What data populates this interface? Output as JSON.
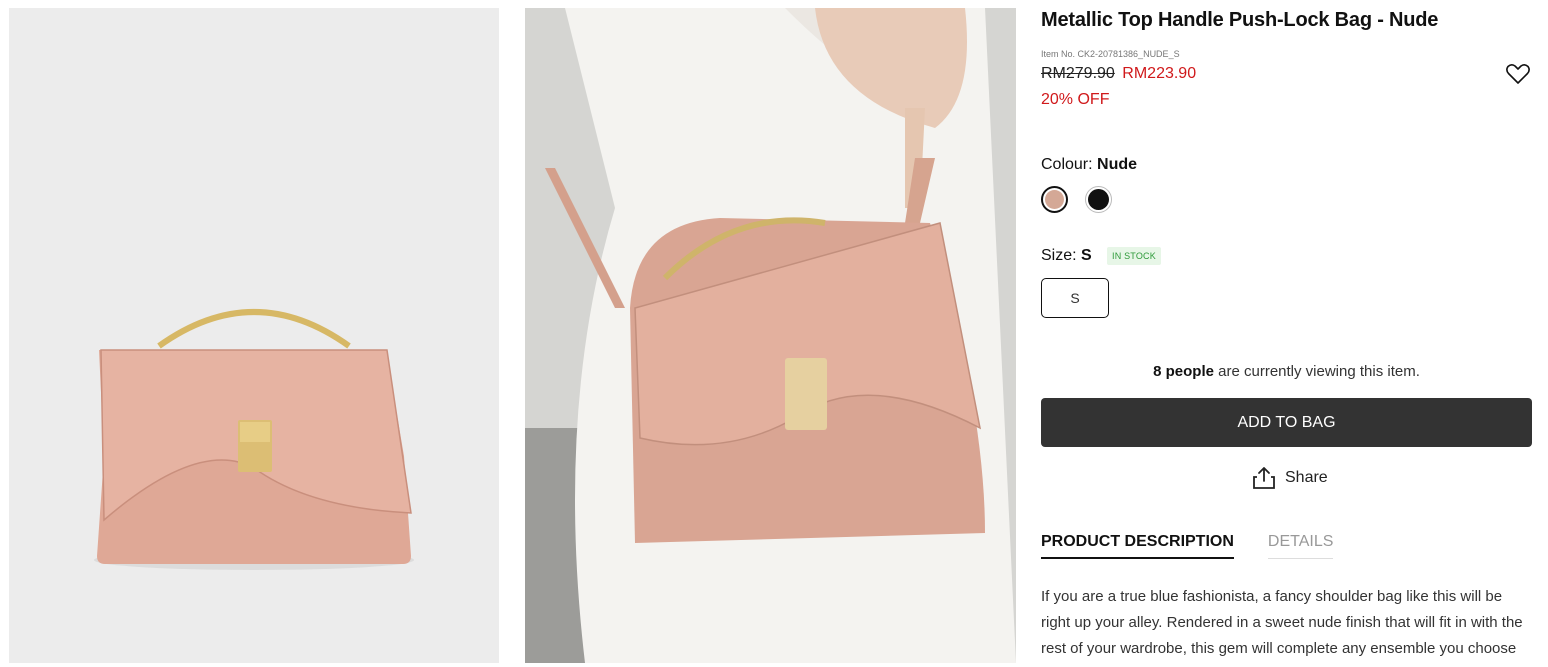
{
  "product": {
    "title": "Metallic Top Handle Push-Lock Bag - Nude",
    "item_no": "Item No. CK2-20781386_NUDE_S",
    "price_original": "RM279.90",
    "price_sale": "RM223.90",
    "discount": "20% OFF"
  },
  "colour": {
    "label": "Colour:",
    "selected": "Nude",
    "options": [
      {
        "name": "Nude",
        "color": "#d4a896"
      },
      {
        "name": "Black",
        "color": "#111111"
      }
    ]
  },
  "size": {
    "label": "Size:",
    "selected": "S",
    "stock_badge": "IN STOCK",
    "options": [
      "S"
    ]
  },
  "viewing": {
    "count": "8 people",
    "text": "are currently viewing this item."
  },
  "actions": {
    "add_to_bag": "ADD TO BAG",
    "share": "Share"
  },
  "tabs": [
    "PRODUCT DESCRIPTION",
    "DETAILS"
  ],
  "description": "If you are a true blue fashionista, a fancy shoulder bag like this will be right up your alley. Rendered in a sweet nude finish that will fit in with the rest of your wardrobe, this gem will complete any ensemble you choose",
  "icons": {
    "wishlist": "heart-icon",
    "share": "share-icon"
  }
}
